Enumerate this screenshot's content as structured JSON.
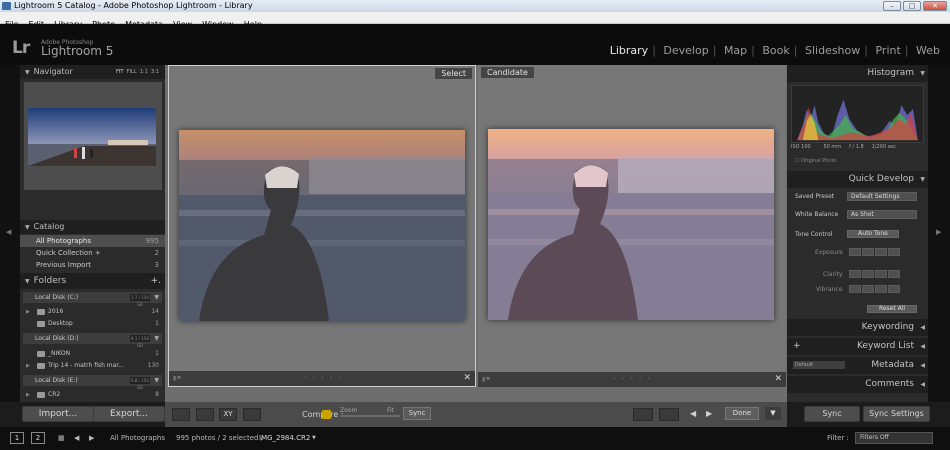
{
  "window": {
    "title": "Lightroom 5 Catalog - Adobe Photoshop Lightroom - Library"
  },
  "menu": [
    "File",
    "Edit",
    "Library",
    "Photo",
    "Metadata",
    "View",
    "Window",
    "Help"
  ],
  "brand": {
    "logo": "Lr",
    "line1": "Adobe Photoshop",
    "line2": "Lightroom 5"
  },
  "modules": [
    {
      "label": "Library",
      "active": true
    },
    {
      "label": "Develop"
    },
    {
      "label": "Map"
    },
    {
      "label": "Book"
    },
    {
      "label": "Slideshow"
    },
    {
      "label": "Print"
    },
    {
      "label": "Web"
    }
  ],
  "navigator": {
    "title": "Navigator",
    "opts": [
      "FIT",
      "FILL",
      "1:1",
      "3:1"
    ]
  },
  "catalog": {
    "title": "Catalog",
    "items": [
      {
        "label": "All Photographs",
        "count": "995"
      },
      {
        "label": "Quick Collection  +",
        "count": "2"
      },
      {
        "label": "Previous Import",
        "count": "3"
      }
    ]
  },
  "folders": {
    "title": "Folders",
    "add": "+.",
    "disks": [
      {
        "label": "Local Disk (C:)",
        "meter": "1.7 / 150 GB"
      },
      {
        "label": "Local Disk (D:)",
        "meter": "9.1 / 158 GB"
      },
      {
        "label": "Local Disk (E:)",
        "meter": "6.8 / 150 GB"
      }
    ],
    "items": [
      {
        "label": "2016",
        "count": "14"
      },
      {
        "label": "Desktop",
        "count": "1"
      },
      {
        "label": "_NIKON",
        "count": "1"
      },
      {
        "label": "Trip 14 - matrh fish mar...",
        "count": "130"
      },
      {
        "label": "CR2",
        "count": "8"
      }
    ]
  },
  "buttons": {
    "import": "Import...",
    "export": "Export...",
    "sync": "Sync",
    "sync_settings": "Sync Settings",
    "done": "Done"
  },
  "compare": {
    "select": "Select",
    "candidate": "Candidate",
    "label": "Compare :",
    "zoom": "Zoom",
    "fit": "Fit",
    "sync": "Sync"
  },
  "histogram": {
    "title": "Histogram",
    "iso": "ISO 100",
    "focal": "50 mm",
    "aperture": "f / 1.8",
    "shutter": "1/200 sec",
    "original": "Original Photo"
  },
  "quick_develop": {
    "title": "Quick Develop",
    "saved_preset_label": "Saved Preset",
    "saved_preset_value": "Default Settings",
    "white_balance_label": "White Balance",
    "white_balance_value": "As Shot",
    "tone_control_label": "Tone Control",
    "auto_tone": "Auto Tone",
    "exposure": "Exposure",
    "clarity": "Clarity",
    "vibrance": "Vibrance",
    "reset_all": "Reset All"
  },
  "panels": {
    "keywording": "Keywording",
    "keyword_list": "Keyword List",
    "metadata": "Metadata",
    "metadata_preset": "Default",
    "comments": "Comments"
  },
  "filmstrip": {
    "page1": "1",
    "page2": "2",
    "source": "All Photographs",
    "info": "995 photos / 2 selected /",
    "filename": "IMG_2984.CR2",
    "filter_label": "Filter :",
    "filter_value": "Filters Off"
  }
}
